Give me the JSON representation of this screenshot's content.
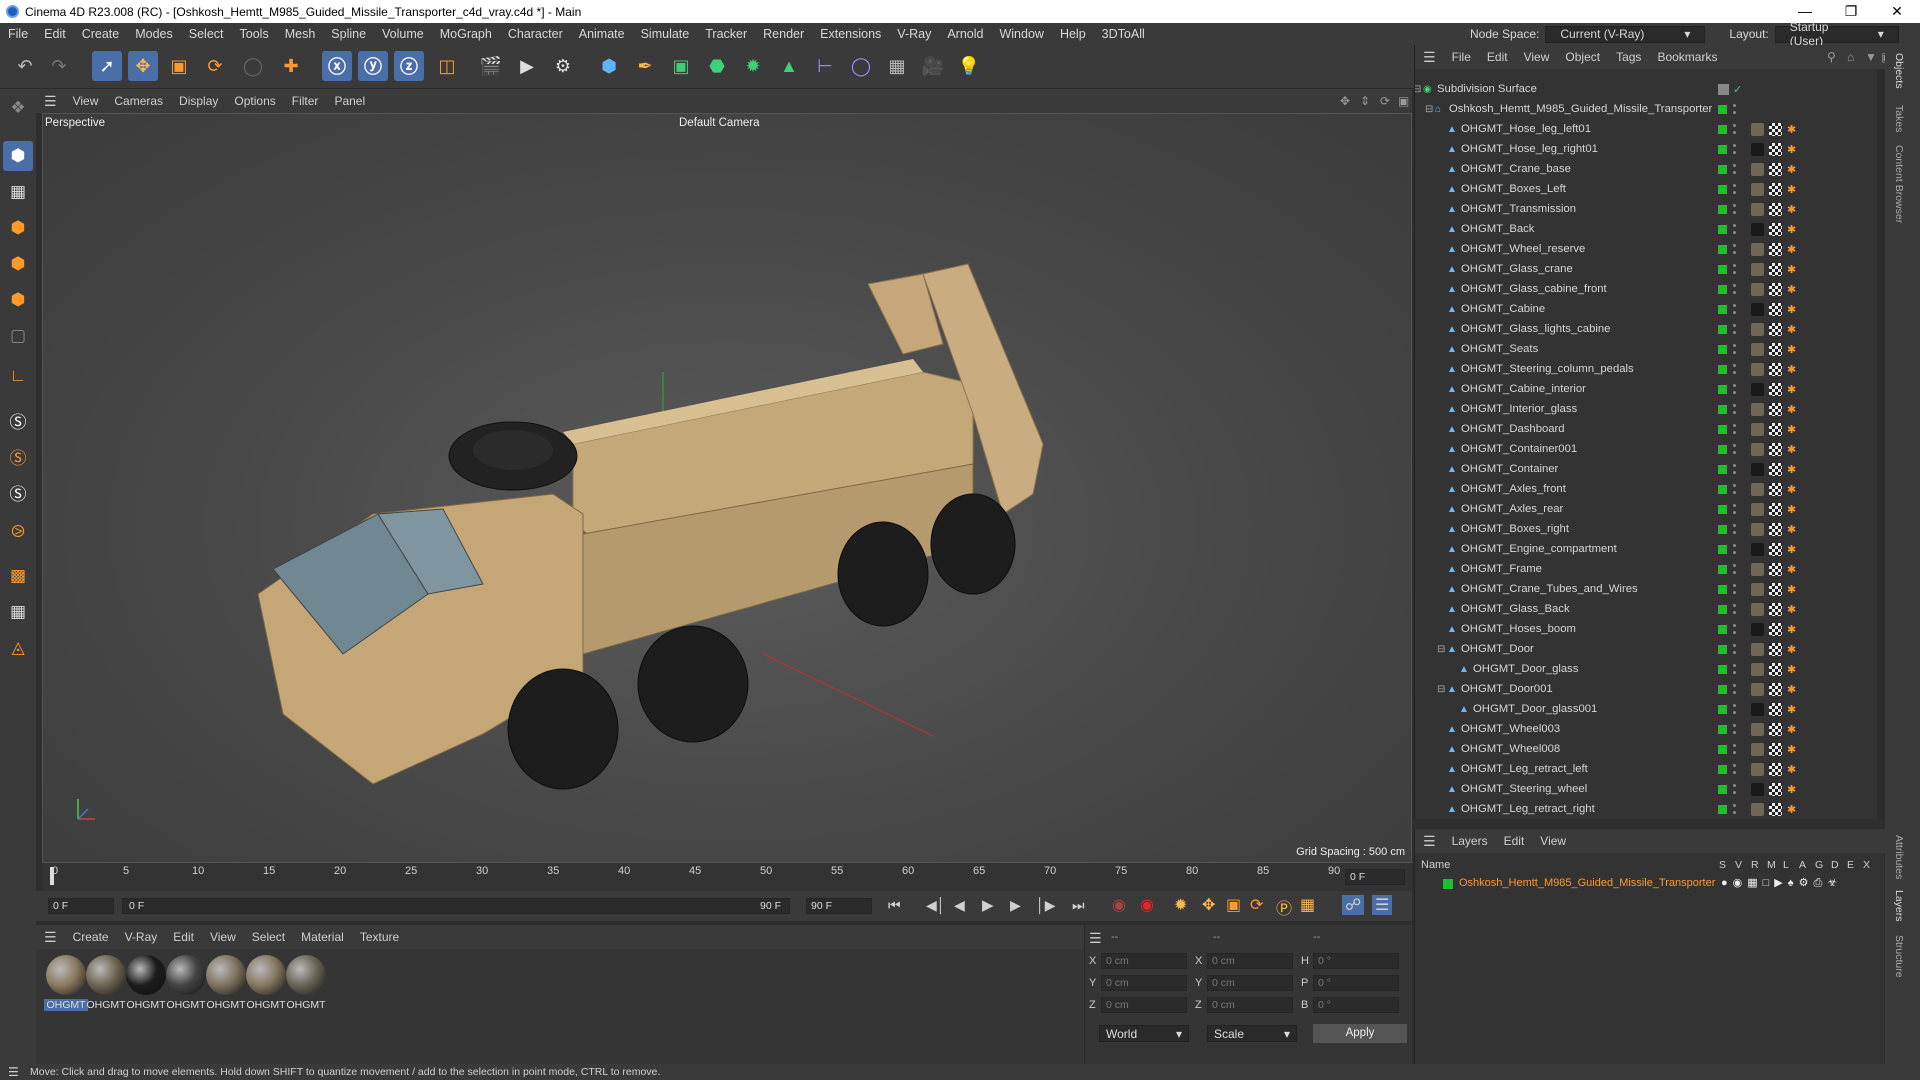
{
  "window": {
    "title": "Cinema 4D R23.008 (RC) - [Oshkosh_Hemtt_M985_Guided_Missile_Transporter_c4d_vray.c4d *] - Main"
  },
  "menubar": {
    "items": [
      "File",
      "Edit",
      "Create",
      "Modes",
      "Select",
      "Tools",
      "Mesh",
      "Spline",
      "Volume",
      "MoGraph",
      "Character",
      "Animate",
      "Simulate",
      "Tracker",
      "Render",
      "Extensions",
      "V-Ray",
      "Arnold",
      "Window",
      "Help",
      "3DToAll"
    ],
    "node_space_label": "Node Space:",
    "node_space_value": "Current (V-Ray)",
    "layout_label": "Layout:",
    "layout_value": "Startup (User)"
  },
  "toolbar": {
    "icons": [
      "undo-icon",
      "redo-icon",
      "live-selection-icon",
      "move-icon",
      "scale-icon",
      "rotate-icon",
      "recent-tools-icon",
      "create-icon",
      "x-axis-icon",
      "y-axis-icon",
      "z-axis-icon",
      "coordinate-system-icon",
      "render-view-icon",
      "render-to-picture-viewer-icon",
      "render-settings-icon",
      "cube-icon",
      "pen-icon",
      "subdivision-icon",
      "extrude-icon",
      "cloner-icon",
      "mograph-icon",
      "symmetry-icon",
      "deformer-icon",
      "floor-icon",
      "camera-icon",
      "light-icon"
    ]
  },
  "viewport": {
    "menu": [
      "View",
      "Cameras",
      "Display",
      "Options",
      "Filter",
      "Panel"
    ],
    "name": "Perspective",
    "camera": "Default Camera",
    "grid_spacing": "Grid Spacing : 500 cm"
  },
  "timeline": {
    "ticks": [
      "0",
      "5",
      "10",
      "15",
      "20",
      "25",
      "30",
      "35",
      "40",
      "45",
      "50",
      "55",
      "60",
      "65",
      "70",
      "75",
      "80",
      "85",
      "90"
    ],
    "current_frame_box": "0 F"
  },
  "transport": {
    "start": "0 F",
    "slider_start": "0 F",
    "slider_end": "90 F",
    "end": "90 F"
  },
  "materials": {
    "menu": [
      "Create",
      "V-Ray",
      "Edit",
      "View",
      "Select",
      "Material",
      "Texture"
    ],
    "items": [
      {
        "label": "OHGMT",
        "color": "#8a7a60"
      },
      {
        "label": "OHGMT",
        "color": "#6e6554"
      },
      {
        "label": "OHGMT",
        "color": "#1c1c1c"
      },
      {
        "label": "OHGMT",
        "color": "#444"
      },
      {
        "label": "OHGMT",
        "color": "#7f735f"
      },
      {
        "label": "OHGMT",
        "color": "#847860"
      },
      {
        "label": "OHGMT",
        "color": "#6a6456"
      }
    ]
  },
  "coords": {
    "headers": [
      "--",
      "--",
      "--"
    ],
    "rows": [
      {
        "a": "X",
        "av": "0 cm",
        "b": "X",
        "bv": "0 cm",
        "c": "H",
        "cv": "0 °"
      },
      {
        "a": "Y",
        "av": "0 cm",
        "b": "Y",
        "bv": "0 cm",
        "c": "P",
        "cv": "0 °"
      },
      {
        "a": "Z",
        "av": "0 cm",
        "b": "Z",
        "bv": "0 cm",
        "c": "B",
        "cv": "0 °"
      }
    ],
    "mode1": "World",
    "mode2": "Scale",
    "apply": "Apply"
  },
  "status": "Move: Click and drag to move elements. Hold down SHIFT to quantize movement / add to the selection in point mode, CTRL to remove.",
  "objects": {
    "menu": [
      "File",
      "Edit",
      "View",
      "Object",
      "Tags",
      "Bookmarks"
    ],
    "rows": [
      {
        "name": "Subdivision Surface",
        "level": 0
      },
      {
        "name": "Oshkosh_Hemtt_M985_Guided_Missile_Transporter",
        "level": 1
      },
      {
        "name": "OHGMT_Hose_leg_left01",
        "level": 2
      },
      {
        "name": "OHGMT_Hose_leg_right01",
        "level": 2
      },
      {
        "name": "OHGMT_Crane_base",
        "level": 2
      },
      {
        "name": "OHGMT_Boxes_Left",
        "level": 2
      },
      {
        "name": "OHGMT_Transmission",
        "level": 2
      },
      {
        "name": "OHGMT_Back",
        "level": 2
      },
      {
        "name": "OHGMT_Wheel_reserve",
        "level": 2
      },
      {
        "name": "OHGMT_Glass_crane",
        "level": 2
      },
      {
        "name": "OHGMT_Glass_cabine_front",
        "level": 2
      },
      {
        "name": "OHGMT_Cabine",
        "level": 2
      },
      {
        "name": "OHGMT_Glass_lights_cabine",
        "level": 2
      },
      {
        "name": "OHGMT_Seats",
        "level": 2
      },
      {
        "name": "OHGMT_Steering_column_pedals",
        "level": 2
      },
      {
        "name": "OHGMT_Cabine_interior",
        "level": 2
      },
      {
        "name": "OHGMT_Interior_glass",
        "level": 2
      },
      {
        "name": "OHGMT_Dashboard",
        "level": 2
      },
      {
        "name": "OHGMT_Container001",
        "level": 2
      },
      {
        "name": "OHGMT_Container",
        "level": 2
      },
      {
        "name": "OHGMT_Axles_front",
        "level": 2
      },
      {
        "name": "OHGMT_Axles_rear",
        "level": 2
      },
      {
        "name": "OHGMT_Boxes_right",
        "level": 2
      },
      {
        "name": "OHGMT_Engine_compartment",
        "level": 2
      },
      {
        "name": "OHGMT_Frame",
        "level": 2
      },
      {
        "name": "OHGMT_Crane_Tubes_and_Wires",
        "level": 2
      },
      {
        "name": "OHGMT_Glass_Back",
        "level": 2
      },
      {
        "name": "OHGMT_Hoses_boom",
        "level": 2
      },
      {
        "name": "OHGMT_Door",
        "level": 2
      },
      {
        "name": "OHGMT_Door_glass",
        "level": 3
      },
      {
        "name": "OHGMT_Door001",
        "level": 2
      },
      {
        "name": "OHGMT_Door_glass001",
        "level": 3
      },
      {
        "name": "OHGMT_Wheel003",
        "level": 2
      },
      {
        "name": "OHGMT_Wheel008",
        "level": 2
      },
      {
        "name": "OHGMT_Leg_retract_left",
        "level": 2
      },
      {
        "name": "OHGMT_Steering_wheel",
        "level": 2
      },
      {
        "name": "OHGMT_Leg_retract_right",
        "level": 2
      }
    ]
  },
  "layers": {
    "menu": [
      "Layers",
      "Edit",
      "View"
    ],
    "name_header": "Name",
    "flags": [
      "S",
      "V",
      "R",
      "M",
      "L",
      "A",
      "G",
      "D",
      "E",
      "X"
    ],
    "layer_name": "Oshkosh_Hemtt_M985_Guided_Missile_Transporter"
  },
  "sidetabs": [
    "Objects",
    "Takes",
    "Content Browser",
    "Attributes",
    "Layers",
    "Structure"
  ]
}
